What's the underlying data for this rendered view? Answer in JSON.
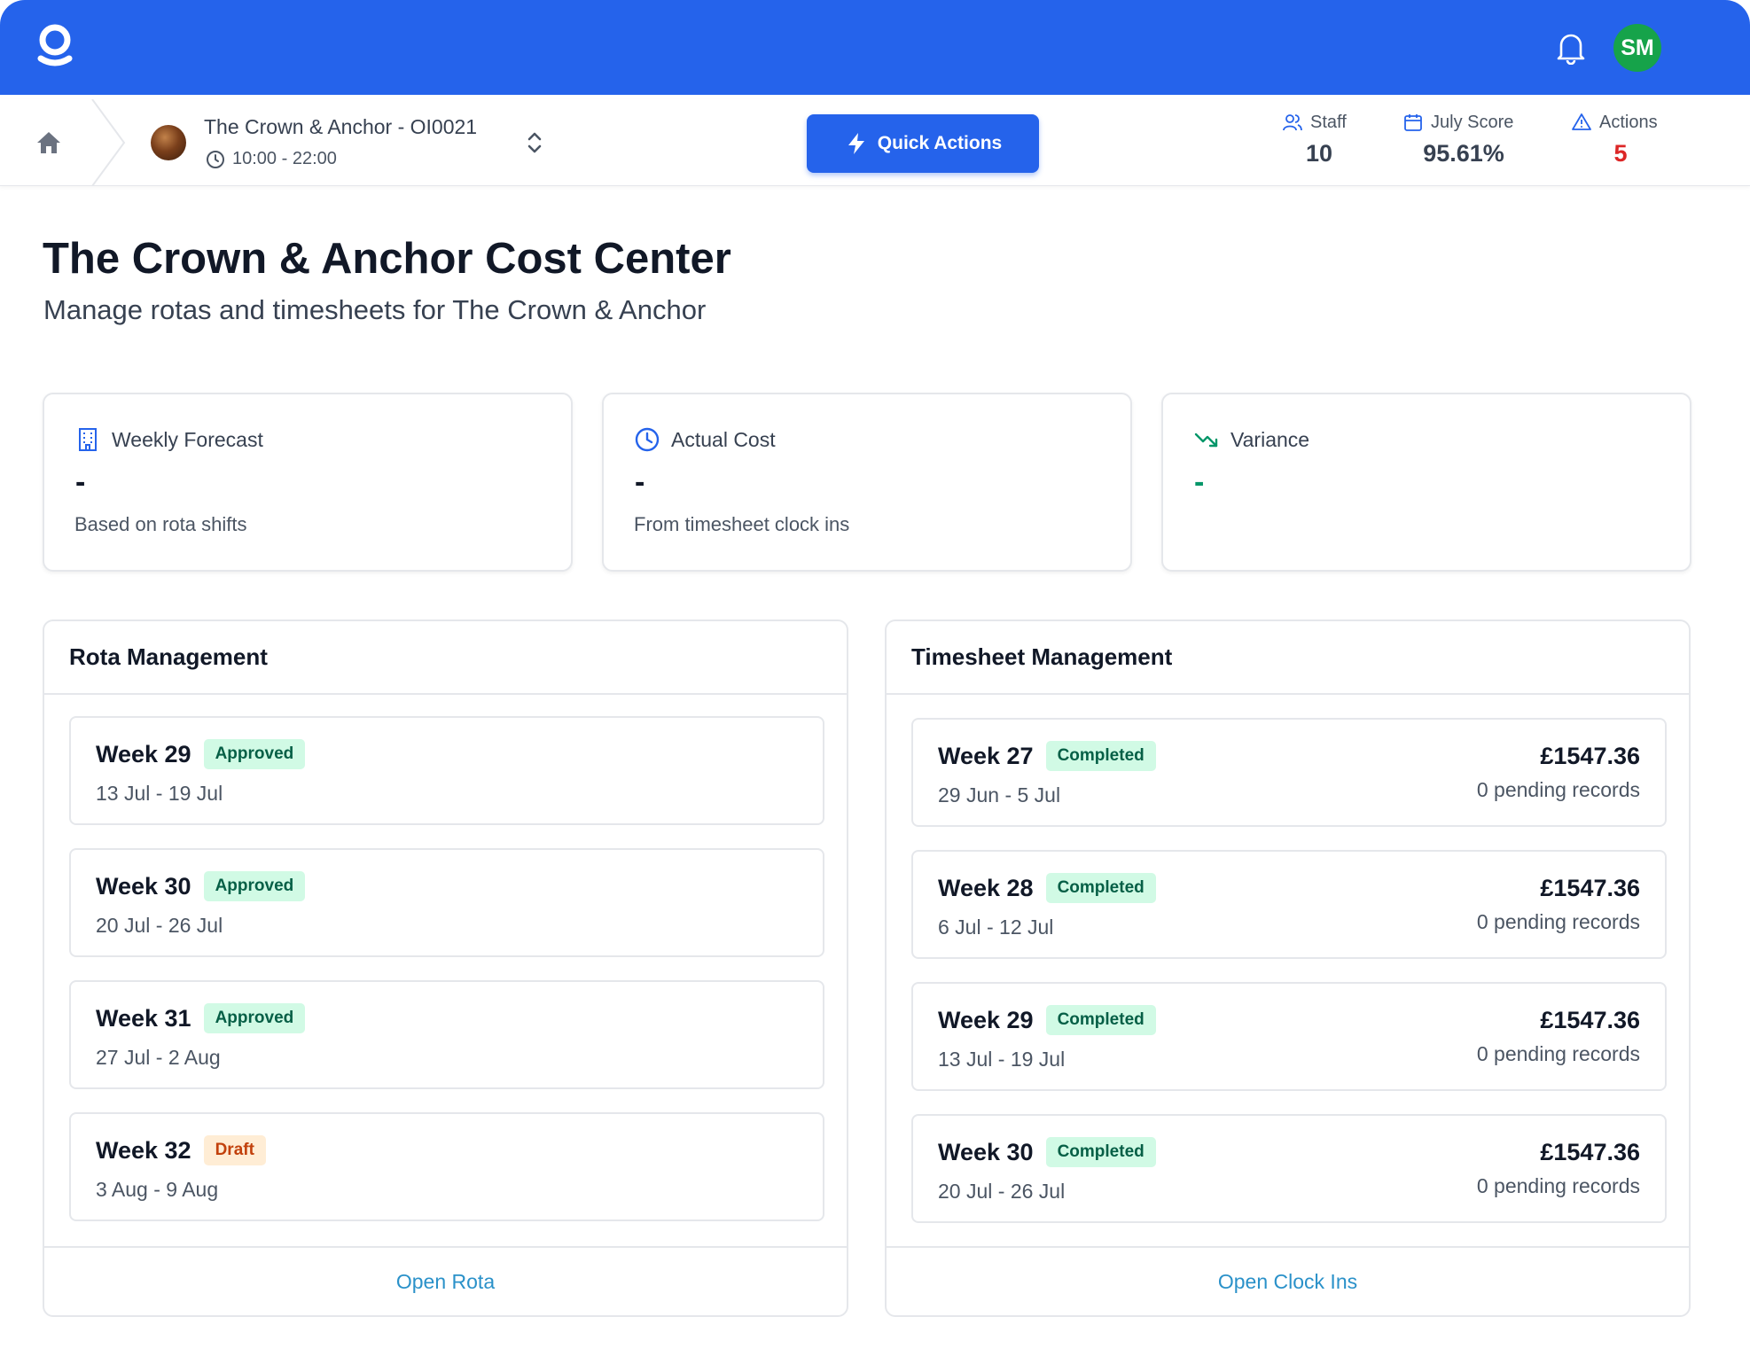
{
  "topbar": {
    "logo_icon": "logo-icon",
    "notification_icon": "bell-icon",
    "user_initials": "SM",
    "user_avatar_color": "#16a34a",
    "bar_color": "#2563eb"
  },
  "subheader": {
    "home_icon": "home-icon",
    "venue_name": "The Crown & Anchor - OI0021",
    "venue_hours": "10:00 - 22:00",
    "quick_actions_label": "Quick Actions",
    "stats": {
      "staff_label": "Staff",
      "staff_value": "10",
      "score_label": "July Score",
      "score_value": "95.61%",
      "actions_label": "Actions",
      "actions_value": "5"
    }
  },
  "page": {
    "title": "The Crown & Anchor Cost Center",
    "subtitle": "Manage rotas and timesheets for The Crown & Anchor"
  },
  "metrics": [
    {
      "label": "Weekly Forecast",
      "value": "-",
      "note": "Based on rota shifts",
      "icon": "building-icon"
    },
    {
      "label": "Actual Cost",
      "value": "-",
      "note": "From timesheet clock ins",
      "icon": "clock-icon"
    },
    {
      "label": "Variance",
      "value": "-",
      "note": "",
      "icon": "trending-down-icon"
    }
  ],
  "rota": {
    "title": "Rota Management",
    "weeks": [
      {
        "week": "Week 29",
        "status": "Approved",
        "dates": "13 Jul - 19 Jul"
      },
      {
        "week": "Week 30",
        "status": "Approved",
        "dates": "20 Jul - 26 Jul"
      },
      {
        "week": "Week 31",
        "status": "Approved",
        "dates": "27 Jul - 2 Aug"
      },
      {
        "week": "Week 32",
        "status": "Draft",
        "dates": "3 Aug - 9 Aug"
      }
    ],
    "footer_link": "Open Rota"
  },
  "timesheet": {
    "title": "Timesheet Management",
    "weeks": [
      {
        "week": "Week 27",
        "status": "Completed",
        "dates": "29 Jun - 5 Jul",
        "amount": "£1547.36",
        "pending": "0 pending records"
      },
      {
        "week": "Week 28",
        "status": "Completed",
        "dates": "6 Jul - 12 Jul",
        "amount": "£1547.36",
        "pending": "0 pending records"
      },
      {
        "week": "Week 29",
        "status": "Completed",
        "dates": "13 Jul - 19 Jul",
        "amount": "£1547.36",
        "pending": "0 pending records"
      },
      {
        "week": "Week 30",
        "status": "Completed",
        "dates": "20 Jul - 26 Jul",
        "amount": "£1547.36",
        "pending": "0 pending records"
      }
    ],
    "footer_link": "Open Clock Ins"
  }
}
